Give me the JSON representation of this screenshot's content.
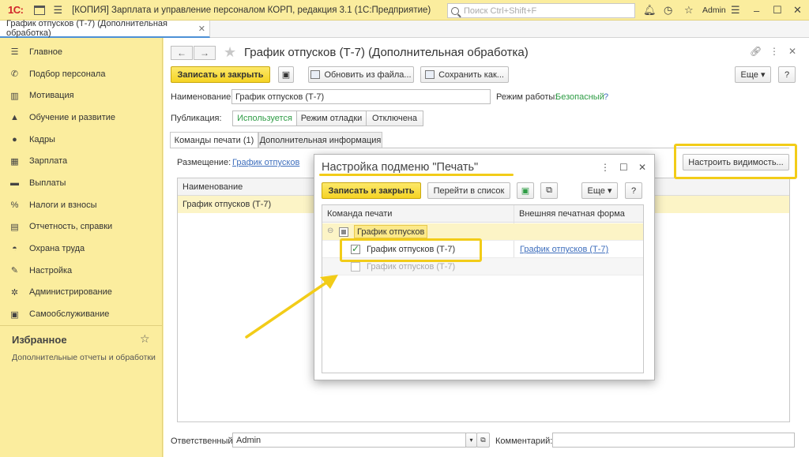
{
  "app": {
    "logo": "1С:",
    "title": "[КОПИЯ] Зарплата и управление персоналом КОРП, редакция 3.1  (1С:Предприятие)",
    "search_placeholder": "Поиск Ctrl+Shift+F",
    "user": "Admin"
  },
  "tab": {
    "label": "График отпусков (Т-7) (Дополнительная обработка)"
  },
  "sidebar": {
    "items": [
      {
        "label": "Главное",
        "icon": "menu-icon"
      },
      {
        "label": "Подбор персонала",
        "icon": "phone-icon"
      },
      {
        "label": "Мотивация",
        "icon": "gift-icon"
      },
      {
        "label": "Обучение и развитие",
        "icon": "graduation-icon"
      },
      {
        "label": "Кадры",
        "icon": "people-icon"
      },
      {
        "label": "Зарплата",
        "icon": "calculator-icon"
      },
      {
        "label": "Выплаты",
        "icon": "wallet-icon"
      },
      {
        "label": "Налоги и взносы",
        "icon": "percent-icon"
      },
      {
        "label": "Отчетность, справки",
        "icon": "report-icon"
      },
      {
        "label": "Охрана труда",
        "icon": "helmet-icon"
      },
      {
        "label": "Настройка",
        "icon": "wrench-icon"
      },
      {
        "label": "Администрирование",
        "icon": "gear-icon"
      },
      {
        "label": "Самообслуживание",
        "icon": "id-card-icon"
      }
    ],
    "favorites_title": "Избранное",
    "favorites_item": "Дополнительные отчеты и обработки"
  },
  "form": {
    "title": "График отпусков (Т-7) (Дополнительная обработка)",
    "save_close": "Записать и закрыть",
    "update_from_file": "Обновить из файла...",
    "save_as": "Сохранить как...",
    "more": "Еще",
    "help": "?",
    "name_label": "Наименование:",
    "name_value": "График отпусков (Т-7)",
    "mode_label": "Режим работы:",
    "mode_value": "Безопасный",
    "publication_label": "Публикация:",
    "publication_options": [
      "Используется",
      "Режим отладки",
      "Отключена"
    ],
    "publication_selected": "Используется",
    "tabs": [
      "Команды печати (1)",
      "Дополнительная информация"
    ],
    "placement_label": "Размещение:",
    "placement_value": "График отпусков",
    "visibility_button": "Настроить видимость...",
    "grid_header": "Наименование",
    "grid_row": "График отпусков (Т-7)",
    "responsible_label": "Ответственный:",
    "responsible_value": "Admin",
    "comment_label": "Комментарий:",
    "comment_value": ""
  },
  "dialog": {
    "title": "Настройка подменю \"Печать\"",
    "save_close": "Записать и закрыть",
    "go_to_list": "Перейти в список",
    "more": "Еще",
    "help": "?",
    "col_command": "Команда печати",
    "col_external": "Внешняя печатная форма",
    "group_row": "График отпусков",
    "row1_name": "График отпусков (Т-7)",
    "row1_form": "График отпусков (Т-7)",
    "row2_name": "График отпусков (Т-7)"
  },
  "colors": {
    "chrome": "#fbed9e",
    "accent_yellow": "#f2cc18",
    "button_yellow": "#f5d324",
    "link": "#3f6fbd",
    "ok_green": "#2e9c45"
  }
}
